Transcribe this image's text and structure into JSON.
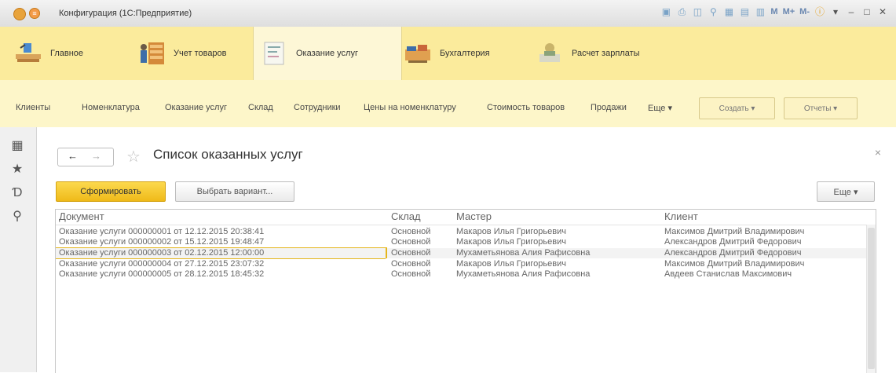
{
  "window": {
    "title": "Конфигурация (1С:Предприятие)",
    "toolbar_text": [
      "M",
      "M+",
      "M-"
    ]
  },
  "sections": [
    {
      "label": "Главное",
      "icon": "desk-icon"
    },
    {
      "label": "Учет товаров",
      "icon": "warehouse-icon"
    },
    {
      "label": "Оказание услуг",
      "icon": "services-icon",
      "active": true
    },
    {
      "label": "Бухгалтерия",
      "icon": "accounting-icon"
    },
    {
      "label": "Расчет зарплаты",
      "icon": "payroll-icon"
    }
  ],
  "navbar": {
    "items": [
      "Клиенты",
      "Номенклатура",
      "Оказание услуг",
      "Склад",
      "Сотрудники",
      "Цены на номенклатуру",
      "Стоимость товаров",
      "Продажи",
      "Еще ▾"
    ],
    "create_label": "Создать ▾",
    "reports_label": "Отчеты ▾"
  },
  "page": {
    "title": "Список оказанных услуг",
    "generate_label": "Сформировать",
    "variant_label": "Выбрать вариант...",
    "more_label": "Еще  ▾"
  },
  "table": {
    "columns": [
      "Документ",
      "Склад",
      "Мастер",
      "Клиент"
    ],
    "rows": [
      [
        "Оказание услуги 000000001 от 12.12.2015 20:38:41",
        "Основной",
        "Макаров Илья Григорьевич",
        "Максимов Дмитрий Владимирович"
      ],
      [
        "Оказание услуги 000000002 от 15.12.2015 19:48:47",
        "Основной",
        "Макаров Илья Григорьевич",
        "Александров Дмитрий Федорович"
      ],
      [
        "Оказание услуги 000000003 от 02.12.2015 12:00:00",
        "Основной",
        "Мухаметьянова Алия Рафисовна",
        "Александров Дмитрий Федорович"
      ],
      [
        "Оказание услуги 000000004 от 27.12.2015 23:07:32",
        "Основной",
        "Макаров Илья Григорьевич",
        "Максимов Дмитрий Владимирович"
      ],
      [
        "Оказание услуги 000000005 от 28.12.2015 18:45:32",
        "Основной",
        "Мухаметьянова Алия Рафисовна",
        "Авдеев Станислав Максимович"
      ]
    ],
    "selected_row": 2
  },
  "colors": {
    "section_bg": "#fbeb9c",
    "nav_bg": "#fdf6c9",
    "primary_button": "#f5c52b",
    "selection_accent": "#e5b61c"
  }
}
